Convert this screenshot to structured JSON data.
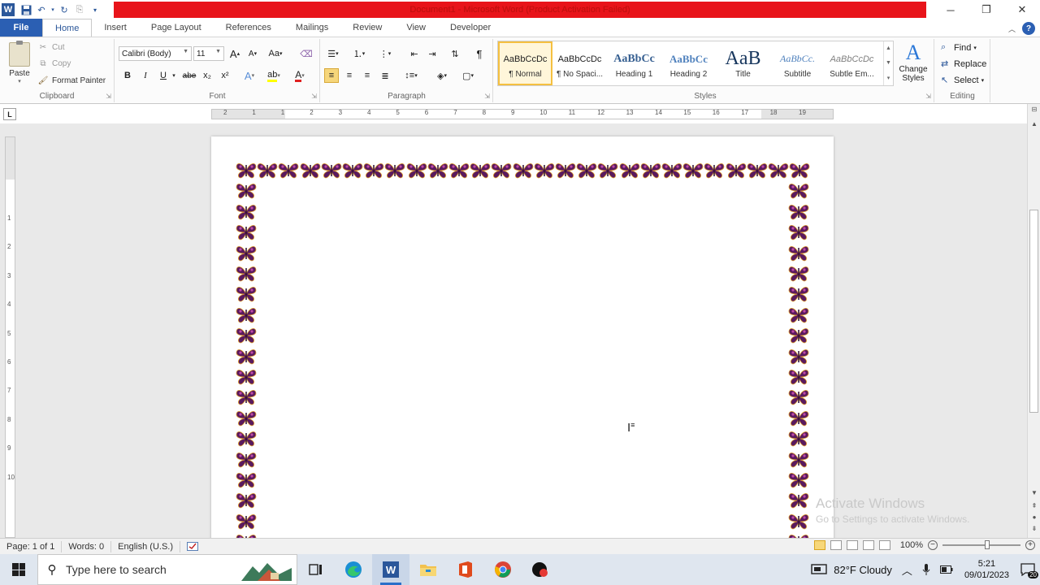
{
  "window": {
    "title": "Document1 - Microsoft Word (Product Activation Failed)",
    "minimize": "─",
    "restore": "❐",
    "close": "✕"
  },
  "tabs": [
    {
      "label": "File"
    },
    {
      "label": "Home"
    },
    {
      "label": "Insert"
    },
    {
      "label": "Page Layout"
    },
    {
      "label": "References"
    },
    {
      "label": "Mailings"
    },
    {
      "label": "Review"
    },
    {
      "label": "View"
    },
    {
      "label": "Developer"
    }
  ],
  "clipboard": {
    "paste": "Paste",
    "cut": "Cut",
    "copy": "Copy",
    "format_painter": "Format Painter",
    "label": "Clipboard"
  },
  "font": {
    "name": "Calibri (Body)",
    "size": "11",
    "label": "Font",
    "bold": "B",
    "italic": "I",
    "underline": "U",
    "strike": "abe",
    "subscript": "x₂",
    "superscript": "x²",
    "grow": "A",
    "shrink": "A",
    "case": "Aa"
  },
  "paragraph": {
    "label": "Paragraph",
    "pilcrow": "¶"
  },
  "styles": {
    "label": "Styles",
    "items": [
      {
        "sample": "AaBbCcDc",
        "name": "¶ Normal"
      },
      {
        "sample": "AaBbCcDc",
        "name": "¶ No Spaci..."
      },
      {
        "sample": "AaBbCc",
        "name": "Heading 1"
      },
      {
        "sample": "AaBbCc",
        "name": "Heading 2"
      },
      {
        "sample": "AaB",
        "name": "Title"
      },
      {
        "sample": "AaBbCc.",
        "name": "Subtitle"
      },
      {
        "sample": "AaBbCcDc",
        "name": "Subtle Em..."
      }
    ],
    "change_styles": "Change Styles"
  },
  "editing": {
    "label": "Editing",
    "find": "Find",
    "replace": "Replace",
    "select": "Select"
  },
  "ruler": {
    "tab_stop": "L",
    "h_numbers": [
      "2",
      "1",
      "1",
      "2",
      "3",
      "4",
      "5",
      "6",
      "7",
      "8",
      "9",
      "10",
      "11",
      "12",
      "13",
      "14",
      "15",
      "16",
      "17",
      "18",
      "19"
    ],
    "v_numbers": [
      "1",
      "2",
      "3",
      "4",
      "5",
      "6",
      "7",
      "8",
      "9",
      "10"
    ]
  },
  "watermark": {
    "line1": "Activate Windows",
    "line2": "Go to Settings to activate Windows."
  },
  "status": {
    "page": "Page: 1 of 1",
    "words": "Words: 0",
    "language": "English (U.S.)",
    "zoom": "100%"
  },
  "taskbar": {
    "search_placeholder": "Type here to search",
    "weather": "82°F  Cloudy",
    "time": "5:21",
    "date": "09/01/2023",
    "notifications": "20"
  },
  "colors": {
    "title_bar_red": "#e8141a",
    "file_tab": "#2b5fb3",
    "butterfly": "#5a1a5e"
  }
}
